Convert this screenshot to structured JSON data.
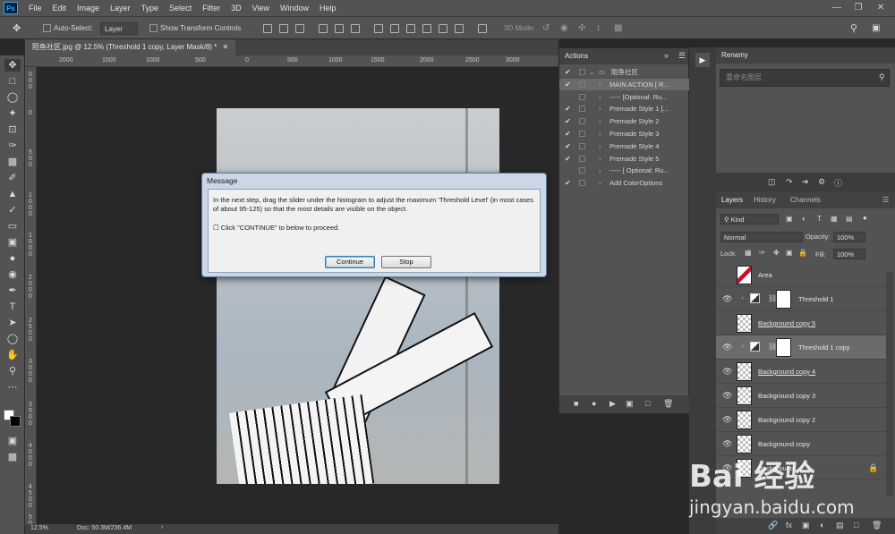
{
  "menu": {
    "logo": "Ps",
    "items": [
      "File",
      "Edit",
      "Image",
      "Layer",
      "Type",
      "Select",
      "Filter",
      "3D",
      "View",
      "Window",
      "Help"
    ]
  },
  "options_bar": {
    "auto_select_label": "Auto-Select:",
    "auto_select_value": "Layer",
    "show_transform_label": "Show Transform Controls",
    "mode_3d_label": "3D Mode:"
  },
  "document": {
    "tab_title": "陌鱼社区.jpg @ 12.5% (Threshold 1 copy, Layer Mask/8) *",
    "zoom": "12.5%",
    "doc_info": "Doc: 50.3M/236.4M",
    "ruler_h_ticks": [
      "2000",
      "1500",
      "1000",
      "500",
      "0",
      "500",
      "1000",
      "1500",
      "2000",
      "2500",
      "3000",
      "3500",
      "4000",
      "4500"
    ],
    "ruler_v_ticks": [
      "5 0 0",
      "0",
      "5 0 0",
      "1 0 0 0",
      "1 5 0 0",
      "2 0 0 0",
      "2 5 0 0",
      "3 0 0 0",
      "3 5 0 0",
      "4 0 0 0",
      "4 5 0 0",
      "5 0 0 0"
    ]
  },
  "dialog": {
    "title": "Message",
    "message": "In the next step, drag the slider under the histogram to adjust the maximum 'Threshold Level' (in most cases of about 95-125) so that the most details are visible on the object.",
    "checkbox_text": "☐ Click \"CONTINUE\" to below to proceed.",
    "continue_label": "Continue",
    "stop_label": "Stop"
  },
  "actions_panel": {
    "title": "Actions",
    "rows": [
      {
        "check": "✔",
        "label": "陌鱼社区",
        "folder": true
      },
      {
        "check": "✔",
        "label": "MAIN ACTION [ R..."
      },
      {
        "check": "",
        "label": "----- [Optional: Ru..."
      },
      {
        "check": "✔",
        "label": "Premade Style 1 [..."
      },
      {
        "check": "✔",
        "label": "Premade Style 2"
      },
      {
        "check": "✔",
        "label": "Premade Style 3"
      },
      {
        "check": "✔",
        "label": "Premade Style 4"
      },
      {
        "check": "✔",
        "label": "Premade Style 5"
      },
      {
        "check": "",
        "label": "----- [ Optional: Ru..."
      },
      {
        "check": "✔",
        "label": "Add ColorOptions"
      }
    ]
  },
  "renamy": {
    "title": "Renamy",
    "search_placeholder": "重命名图层"
  },
  "layers_panel": {
    "tabs": [
      "Layers",
      "History",
      "Channels"
    ],
    "kind_label": "Kind",
    "blend_mode": "Normal",
    "opacity_label": "Opacity:",
    "opacity_value": "100%",
    "lock_label": "Lock:",
    "fill_label": "Fill:",
    "fill_value": "100%",
    "layers": [
      {
        "name": "Area",
        "visible": false
      },
      {
        "name": "Threshold 1",
        "visible": true
      },
      {
        "name": "Background copy 5",
        "visible": false
      },
      {
        "name": "Threshold 1 copy",
        "visible": true
      },
      {
        "name": "Background copy 4",
        "visible": true
      },
      {
        "name": "Background copy 3",
        "visible": true
      },
      {
        "name": "Background copy 2",
        "visible": true
      },
      {
        "name": "Background copy",
        "visible": true
      },
      {
        "name": "Background",
        "visible": true
      }
    ]
  },
  "watermark": {
    "logo_text": "Bai 经验",
    "url": "jingyan.baidu.com"
  }
}
